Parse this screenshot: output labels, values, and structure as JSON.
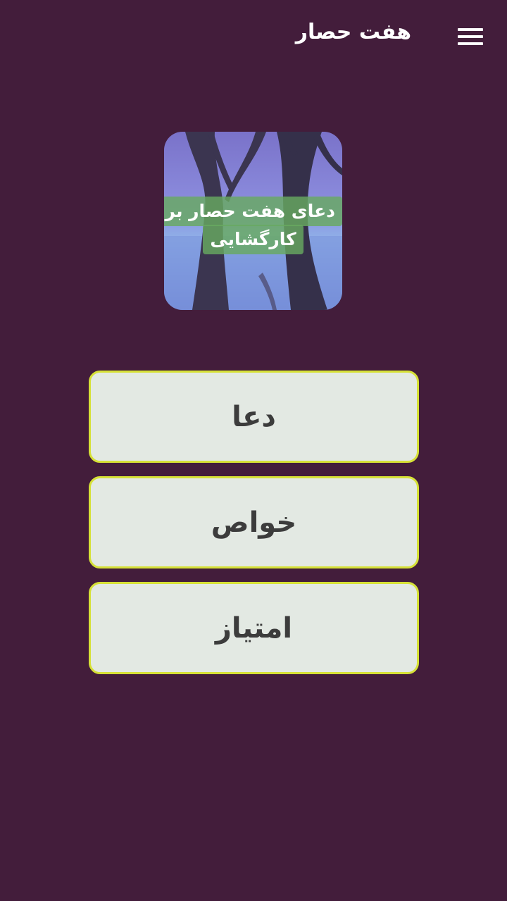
{
  "app_bar": {
    "title": "هفت حصار",
    "menu_icon": "hamburger-menu-icon"
  },
  "cover": {
    "caption_line1": "دعای هفت حصار برای",
    "caption_line2": "کارگشایی"
  },
  "menu": {
    "items": [
      {
        "label": "دعا"
      },
      {
        "label": "خواص"
      },
      {
        "label": "امتیاز"
      }
    ]
  },
  "colors": {
    "background": "#431d3b",
    "button_fill": "#e3e9e3",
    "button_border": "#d6e137",
    "caption_bg": "#68aa60"
  }
}
